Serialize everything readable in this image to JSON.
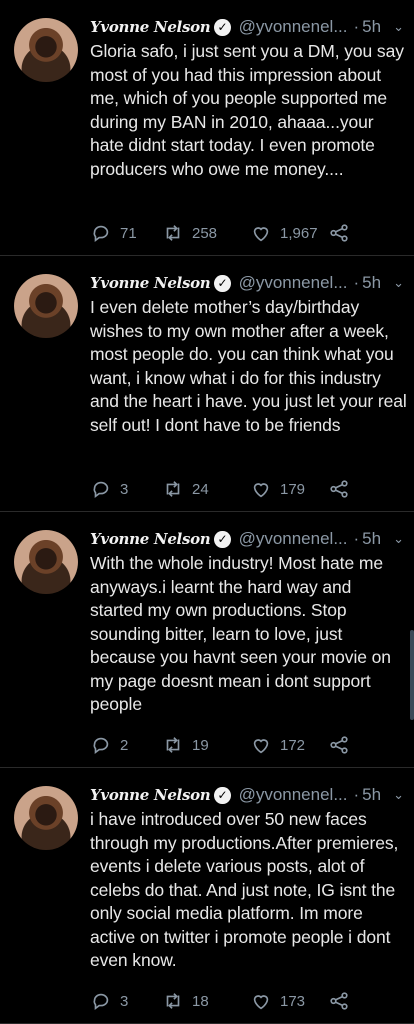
{
  "tweets": [
    {
      "name": "Yvonne Nelson",
      "handle": "@yvonnenel...",
      "separator": "·",
      "time": "5h",
      "text": "Gloria safo, i just sent you a DM, you say most of you had this impression about me, which of you people supported me during my BAN in 2010, ahaaa...your hate didnt start today. I even promote producers who owe me money....",
      "replies": "71",
      "retweets": "258",
      "likes": "1,967"
    },
    {
      "name": "Yvonne Nelson",
      "handle": "@yvonnenel...",
      "separator": "·",
      "time": "5h",
      "text": "I even delete mother’s day/birthday wishes to my own mother after a week, most people do. you can think what you want, i know what i do for this industry and the heart i have. you just let your real self out! I dont have to be friends",
      "replies": "3",
      "retweets": "24",
      "likes": "179"
    },
    {
      "name": "Yvonne Nelson",
      "handle": "@yvonnenel...",
      "separator": "·",
      "time": "5h",
      "text": "With the whole industry! Most hate me anyways.i learnt the hard way and started my own productions. Stop sounding bitter, learn to love, just because you havnt seen your movie on my page doesnt mean i dont support people",
      "replies": "2",
      "retweets": "19",
      "likes": "172"
    },
    {
      "name": "Yvonne Nelson",
      "handle": "@yvonnenel...",
      "separator": "·",
      "time": "5h",
      "text": "i have introduced over 50 new faces through my productions.After premieres, events i delete various posts, alot of celebs do that. And just note, IG isnt the only social media platform. Im more active on twitter i promote people i dont even know.",
      "replies": "3",
      "retweets": "18",
      "likes": "173"
    }
  ],
  "icons": {
    "reply": "reply-icon",
    "retweet": "retweet-icon",
    "like": "heart-icon",
    "share": "share-icon",
    "verified": "verified-badge-icon",
    "menu": "chevron-down-icon"
  },
  "colors": {
    "background": "#000000",
    "text": "#e8e8e8",
    "muted": "#8b98a5"
  }
}
